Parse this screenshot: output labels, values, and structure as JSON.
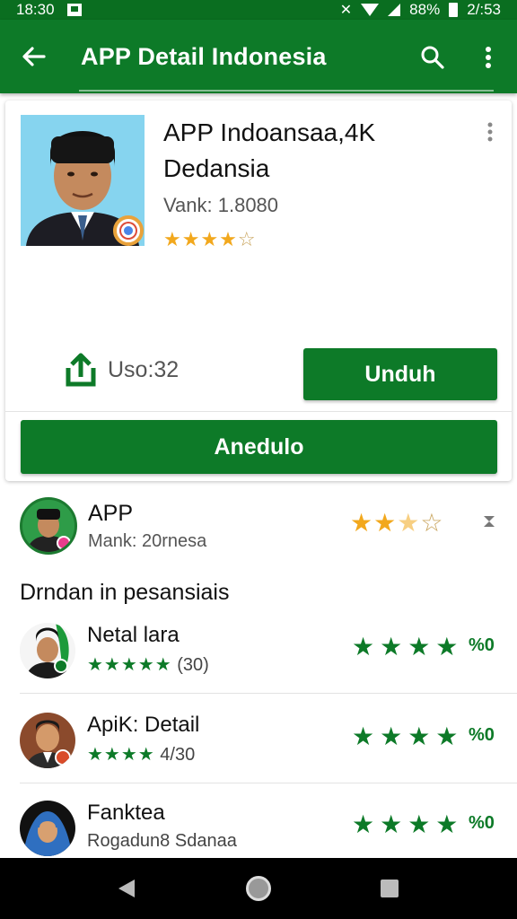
{
  "status_bar": {
    "time": "18:30",
    "battery": "88%",
    "clock_right": "2/:53"
  },
  "app_bar": {
    "title": "APP Detail Indonesia"
  },
  "app": {
    "name_line1": "APP Indoansaa,4K",
    "name_line2": "Dedansia",
    "version": "Vank: 1.8080",
    "stars": "★★★★",
    "star_empty": "☆",
    "share_label": "Uso:32",
    "install_label": "Unduh",
    "open_label": "Anedulo"
  },
  "review": {
    "title": "APP",
    "subtitle": "Mank: 20rnesa",
    "stars": "★★",
    "star_half": "★",
    "star_empty": "☆"
  },
  "section_title": "Drndan in pesansiais",
  "similar": [
    {
      "name": "Netal lara",
      "stars": "★★★★★",
      "sub_text": "(30)",
      "rating": "★★★★",
      "count": "%0"
    },
    {
      "name": "ApiK: Detail",
      "stars": "★★★★",
      "sub_text": "4/30",
      "rating": "★★★★",
      "count": "%0"
    },
    {
      "name": "Fanktea",
      "stars": "",
      "sub_text": "Rogadun8 Sdanaa",
      "rating": "★★★★",
      "count": "%0"
    }
  ],
  "colors": {
    "primary": "#0d7a28",
    "status": "#0a6e20",
    "star_gold": "#f2a81d"
  }
}
